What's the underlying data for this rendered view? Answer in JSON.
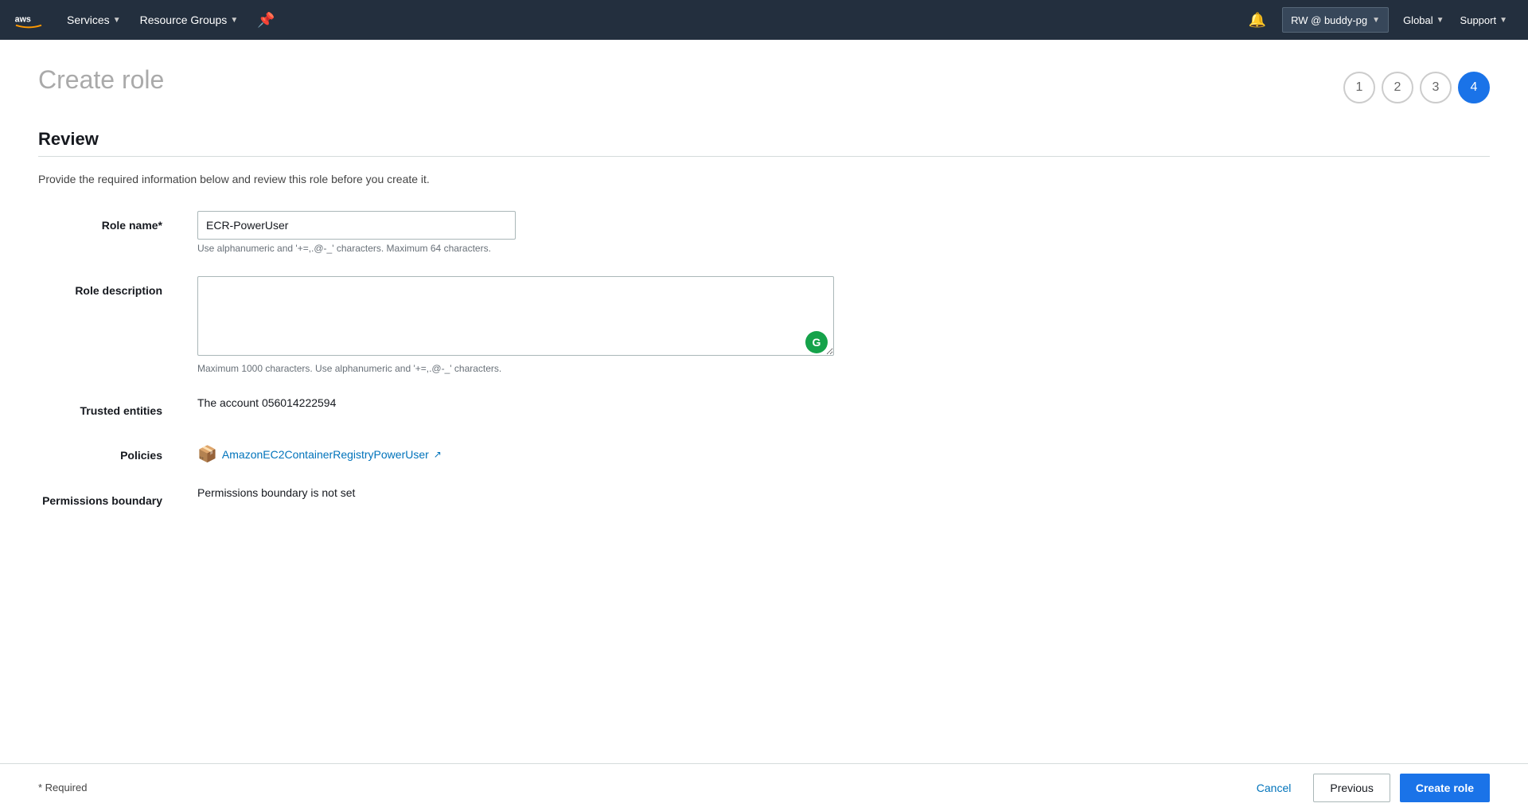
{
  "navbar": {
    "services_label": "Services",
    "resource_groups_label": "Resource Groups",
    "bell_icon": "🔔",
    "account_label": "RW @ buddy-pg",
    "region_label": "Global",
    "support_label": "Support"
  },
  "page": {
    "title": "Create role",
    "description": "Provide the required information below and review this role before you create it."
  },
  "steps": [
    {
      "number": "1",
      "active": false
    },
    {
      "number": "2",
      "active": false
    },
    {
      "number": "3",
      "active": false
    },
    {
      "number": "4",
      "active": true
    }
  ],
  "section": {
    "title": "Review"
  },
  "form": {
    "role_name_label": "Role name*",
    "role_name_value": "ECR-PowerUser",
    "role_name_hint": "Use alphanumeric and '+=,.@-_' characters. Maximum 64 characters.",
    "role_description_label": "Role description",
    "role_description_value": "",
    "role_description_hint": "Maximum 1000 characters. Use alphanumeric and '+=,.@-_' characters.",
    "trusted_entities_label": "Trusted entities",
    "trusted_entities_value": "The account 056014222594",
    "policies_label": "Policies",
    "policy_name": "AmazonEC2ContainerRegistryPowerUser",
    "permissions_boundary_label": "Permissions boundary",
    "permissions_boundary_value": "Permissions boundary is not set"
  },
  "footer": {
    "required_label": "* Required",
    "cancel_label": "Cancel",
    "previous_label": "Previous",
    "create_label": "Create role"
  }
}
